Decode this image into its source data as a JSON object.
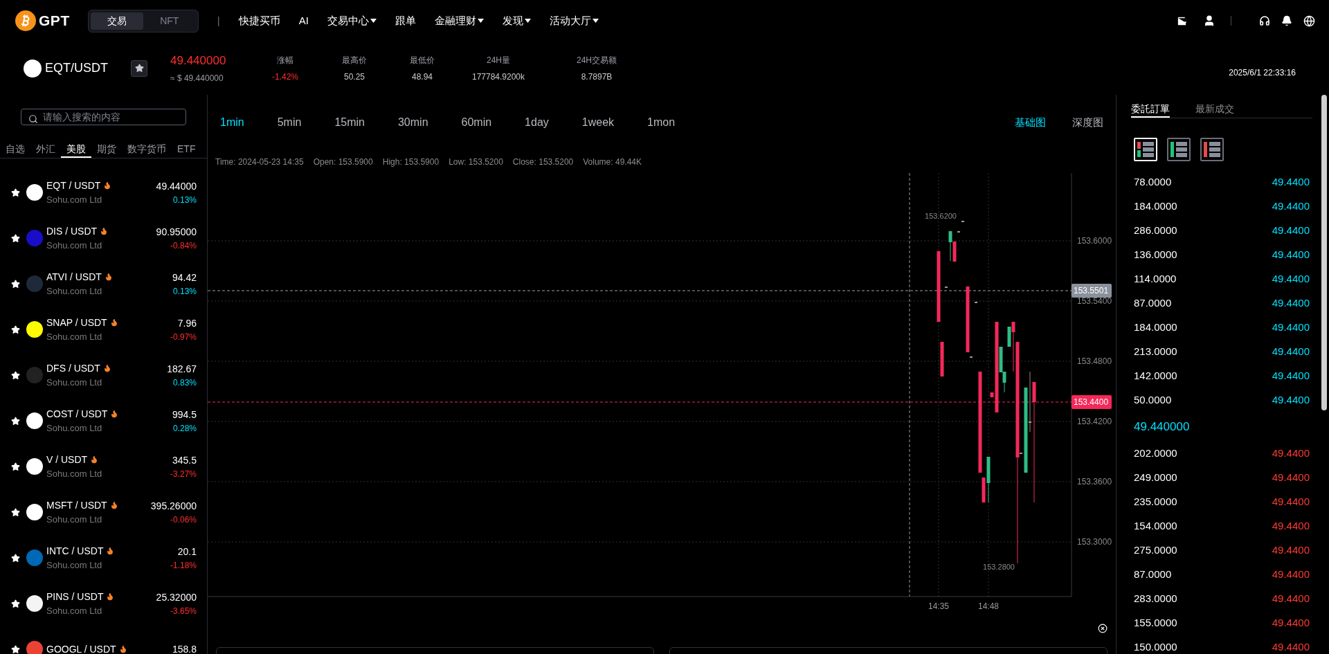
{
  "header": {
    "logo_text": "GPT",
    "modes": [
      {
        "label": "交易",
        "selected": true
      },
      {
        "label": "NFT",
        "selected": false
      }
    ],
    "separator": "|",
    "nav": [
      {
        "label": "快捷买币",
        "has_dropdown": false
      },
      {
        "label": "AI",
        "has_dropdown": false
      },
      {
        "label": "交易中心",
        "has_dropdown": true
      },
      {
        "label": "跟单",
        "has_dropdown": false
      },
      {
        "label": "金融理财",
        "has_dropdown": true
      },
      {
        "label": "发现",
        "has_dropdown": true
      },
      {
        "label": "活动大厅",
        "has_dropdown": true
      }
    ]
  },
  "ticker": {
    "symbol": "EQT/USDT",
    "price": "49.440000",
    "rising": false,
    "price_approx": "≈ $ 49.440000",
    "stats": [
      {
        "label": "涨幅",
        "value": "-1.42%",
        "kind": "change"
      },
      {
        "label": "最高价",
        "value": "50.25",
        "kind": "plain"
      },
      {
        "label": "最低价",
        "value": "48.94",
        "kind": "plain"
      },
      {
        "label": "24H量",
        "value": "177784.9200k",
        "kind": "plain"
      },
      {
        "label": "24H交易额",
        "value": "8.7897B",
        "kind": "plain"
      }
    ],
    "time": "2025/6/1 22:33:16"
  },
  "sidebar": {
    "search": {
      "placeholder": "请输入搜索的内容"
    },
    "tabs": [
      {
        "label": "自选",
        "selected": false
      },
      {
        "label": "外汇",
        "selected": false
      },
      {
        "label": "美股",
        "selected": true
      },
      {
        "label": "期货",
        "selected": false
      },
      {
        "label": "数字货币",
        "selected": false
      },
      {
        "label": "ETF",
        "selected": false
      }
    ],
    "items": [
      {
        "pair": "EQT / USDT",
        "company": "Sohu.com Ltd",
        "price": "49.44000",
        "change": "0.13%",
        "rising": true,
        "color": "#ffffff"
      },
      {
        "pair": "DIS / USDT",
        "company": "Sohu.com Ltd",
        "price": "90.95000",
        "change": "-0.84%",
        "rising": false,
        "color": "#1a0dc8"
      },
      {
        "pair": "ATVI / USDT",
        "company": "Sohu.com Ltd",
        "price": "94.42",
        "change": "0.13%",
        "rising": true,
        "color": "#1e2a3a"
      },
      {
        "pair": "SNAP / USDT",
        "company": "Sohu.com Ltd",
        "price": "7.96",
        "change": "-0.97%",
        "rising": false,
        "color": "#fffc00"
      },
      {
        "pair": "DFS / USDT",
        "company": "Sohu.com Ltd",
        "price": "182.67",
        "change": "0.83%",
        "rising": true,
        "color": "#222222"
      },
      {
        "pair": "COST / USDT",
        "company": "Sohu.com Ltd",
        "price": "994.5",
        "change": "0.28%",
        "rising": true,
        "color": "#ffffff"
      },
      {
        "pair": "V / USDT",
        "company": "Sohu.com Ltd",
        "price": "345.5",
        "change": "-3.27%",
        "rising": false,
        "color": "#ffffff"
      },
      {
        "pair": "MSFT / USDT",
        "company": "Sohu.com Ltd",
        "price": "395.26000",
        "change": "-0.06%",
        "rising": false,
        "color": "#ffffff"
      },
      {
        "pair": "INTC / USDT",
        "company": "Sohu.com Ltd",
        "price": "20.1",
        "change": "-1.18%",
        "rising": false,
        "color": "#0068b5"
      },
      {
        "pair": "PINS / USDT",
        "company": "Sohu.com Ltd",
        "price": "25.32000",
        "change": "-3.65%",
        "rising": false,
        "color": "#f4f4f4"
      },
      {
        "pair": "GOOGL / USDT",
        "price": "158.8",
        "color": "#ea4335"
      }
    ]
  },
  "chart": {
    "intervals": [
      {
        "label": "1min",
        "selected": true
      },
      {
        "label": "5min",
        "selected": false
      },
      {
        "label": "15min",
        "selected": false
      },
      {
        "label": "30min",
        "selected": false
      },
      {
        "label": "60min",
        "selected": false
      },
      {
        "label": "1day",
        "selected": false
      },
      {
        "label": "1week",
        "selected": false
      },
      {
        "label": "1mon",
        "selected": false
      }
    ],
    "views": [
      {
        "label": "基础图",
        "selected": true
      },
      {
        "label": "深度图",
        "selected": false
      }
    ],
    "info": [
      "Time: 2024-05-23 14:35",
      "Open: 153.5900",
      "High: 153.5900",
      "Low: 153.5200",
      "Close: 153.5200",
      "Volume: 49.44K"
    ],
    "y_ticks": [
      "153.6000",
      "153.5400",
      "153.4800",
      "153.4200",
      "153.3600",
      "153.3000"
    ],
    "x_ticks": [
      "14:35",
      "14:48"
    ],
    "high_label": "153.6200",
    "low_label": "153.2800",
    "crosshair_price": "153.5501",
    "last_price": "153.4400"
  },
  "orderbook": {
    "tabs": [
      {
        "label": "委託訂單",
        "selected": true
      },
      {
        "label": "最新成交",
        "selected": false
      }
    ],
    "layouts": [
      {
        "kind": "both",
        "selected": true
      },
      {
        "kind": "green",
        "selected": false
      },
      {
        "kind": "red",
        "selected": false
      }
    ],
    "upper_rows": [
      {
        "amount": "78.0000",
        "price": "49.4400"
      },
      {
        "amount": "184.0000",
        "price": "49.4400"
      },
      {
        "amount": "286.0000",
        "price": "49.4400"
      },
      {
        "amount": "136.0000",
        "price": "49.4400"
      },
      {
        "amount": "114.0000",
        "price": "49.4400"
      },
      {
        "amount": "87.0000",
        "price": "49.4400"
      },
      {
        "amount": "184.0000",
        "price": "49.4400"
      },
      {
        "amount": "213.0000",
        "price": "49.4400"
      },
      {
        "amount": "142.0000",
        "price": "49.4400"
      },
      {
        "amount": "50.0000",
        "price": "49.4400"
      }
    ],
    "mid_price": "49.440000",
    "lower_rows": [
      {
        "amount": "202.0000",
        "price": "49.4400"
      },
      {
        "amount": "249.0000",
        "price": "49.4400"
      },
      {
        "amount": "235.0000",
        "price": "49.4400"
      },
      {
        "amount": "154.0000",
        "price": "49.4400"
      },
      {
        "amount": "275.0000",
        "price": "49.4400"
      },
      {
        "amount": "87.0000",
        "price": "49.4400"
      },
      {
        "amount": "283.0000",
        "price": "49.4400"
      },
      {
        "amount": "155.0000",
        "price": "49.4400"
      },
      {
        "amount": "150.0000",
        "price": "49.4400"
      }
    ]
  }
}
